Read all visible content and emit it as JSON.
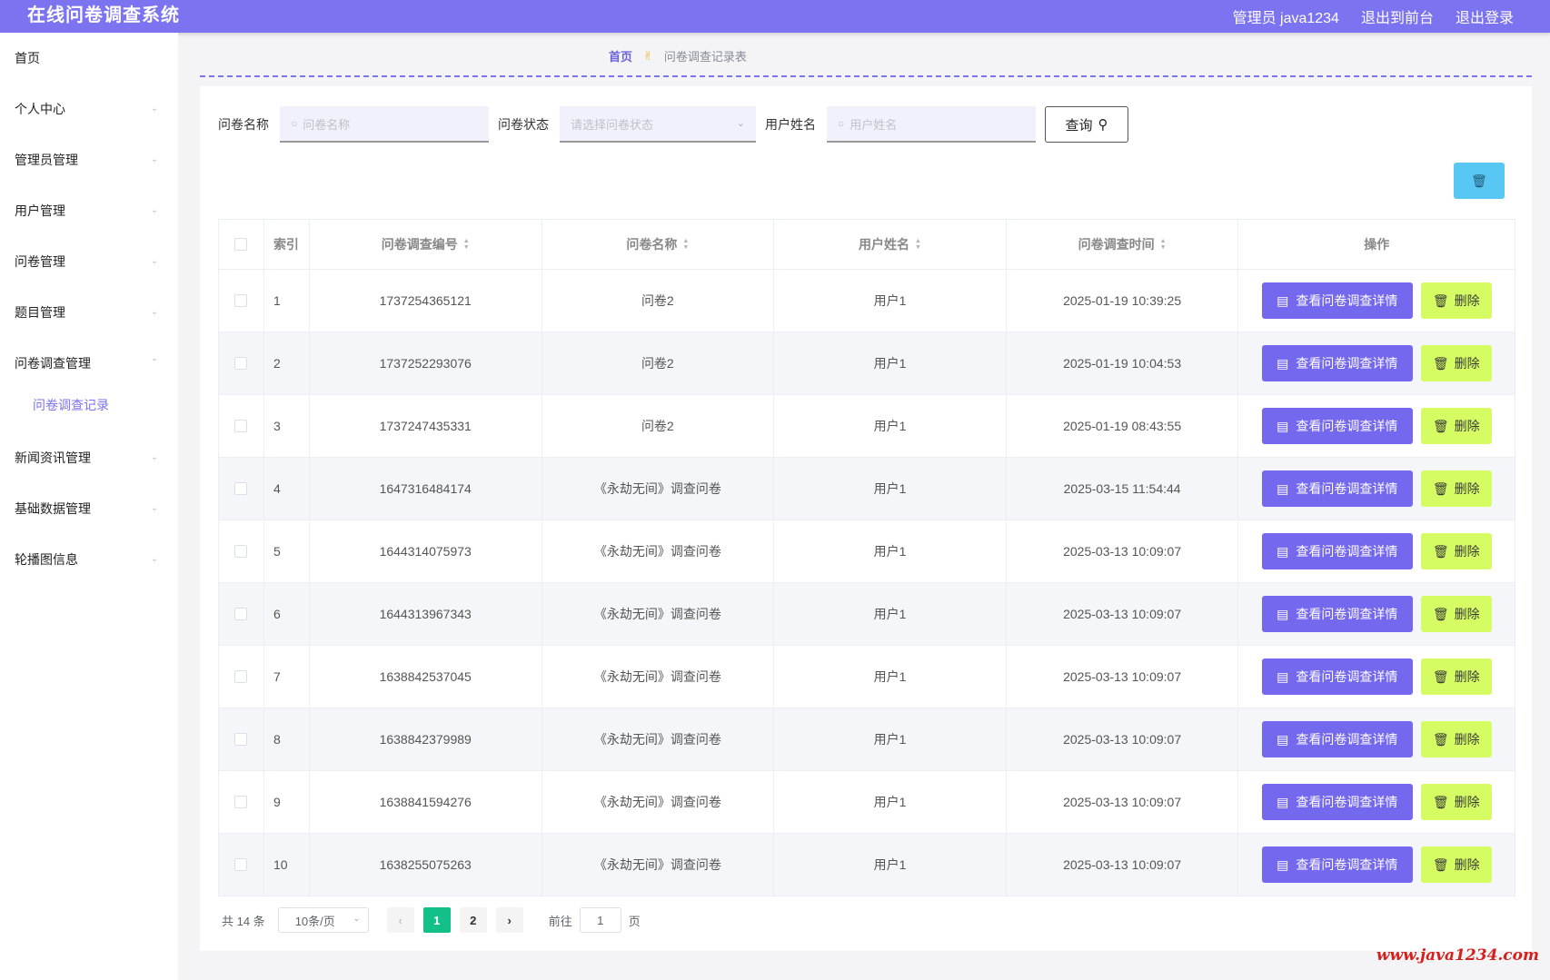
{
  "header": {
    "title": "在线问卷调查系统",
    "admin_label": "管理员 java1234",
    "to_front": "退出到前台",
    "logout": "退出登录",
    "bar_color": "#7c73f0"
  },
  "sidebar": {
    "items": [
      {
        "label": "首页",
        "chevron": ""
      },
      {
        "label": "个人中心",
        "chevron": "⌄"
      },
      {
        "label": "管理员管理",
        "chevron": "⌄"
      },
      {
        "label": "用户管理",
        "chevron": "⌄"
      },
      {
        "label": "问卷管理",
        "chevron": "⌄"
      },
      {
        "label": "题目管理",
        "chevron": "⌄"
      },
      {
        "label": "问卷调查管理",
        "chevron": "⌃"
      },
      {
        "label": "新闻资讯管理",
        "chevron": "⌄"
      },
      {
        "label": "基础数据管理",
        "chevron": "⌄"
      },
      {
        "label": "轮播图信息",
        "chevron": "⌄"
      }
    ],
    "sub_item": "问卷调查记录"
  },
  "breadcrumb": {
    "home": "首页",
    "current": "问卷调查记录表"
  },
  "search": {
    "name_label": "问卷名称",
    "name_placeholder": "问卷名称",
    "status_label": "问卷状态",
    "status_placeholder": "请选择问卷状态",
    "user_label": "用户姓名",
    "user_placeholder": "用户姓名",
    "query_label": "查询"
  },
  "table": {
    "headers": {
      "index": "索引",
      "code": "问卷调查编号",
      "name": "问卷名称",
      "user": "用户姓名",
      "time": "问卷调查时间",
      "ops": "操作"
    },
    "view_label": "查看问卷调查详情",
    "delete_label": "删除",
    "rows": [
      {
        "index": "1",
        "code": "1737254365121",
        "name": "问卷2",
        "user": "用户1",
        "time": "2025-01-19 10:39:25"
      },
      {
        "index": "2",
        "code": "1737252293076",
        "name": "问卷2",
        "user": "用户1",
        "time": "2025-01-19 10:04:53"
      },
      {
        "index": "3",
        "code": "1737247435331",
        "name": "问卷2",
        "user": "用户1",
        "time": "2025-01-19 08:43:55"
      },
      {
        "index": "4",
        "code": "1647316484174",
        "name": "《永劫无间》调查问卷",
        "user": "用户1",
        "time": "2025-03-15 11:54:44"
      },
      {
        "index": "5",
        "code": "1644314075973",
        "name": "《永劫无间》调查问卷",
        "user": "用户1",
        "time": "2025-03-13 10:09:07"
      },
      {
        "index": "6",
        "code": "1644313967343",
        "name": "《永劫无间》调查问卷",
        "user": "用户1",
        "time": "2025-03-13 10:09:07"
      },
      {
        "index": "7",
        "code": "1638842537045",
        "name": "《永劫无间》调查问卷",
        "user": "用户1",
        "time": "2025-03-13 10:09:07"
      },
      {
        "index": "8",
        "code": "1638842379989",
        "name": "《永劫无间》调查问卷",
        "user": "用户1",
        "time": "2025-03-13 10:09:07"
      },
      {
        "index": "9",
        "code": "1638841594276",
        "name": "《永劫无间》调查问卷",
        "user": "用户1",
        "time": "2025-03-13 10:09:07"
      },
      {
        "index": "10",
        "code": "1638255075263",
        "name": "《永劫无间》调查问卷",
        "user": "用户1",
        "time": "2025-03-13 10:09:07"
      }
    ]
  },
  "pagination": {
    "total": "共 14 条",
    "page_size": "10条/页",
    "pages": [
      "1",
      "2"
    ],
    "current_page": "1",
    "goto_prefix": "前往",
    "goto_value": "1",
    "goto_suffix": "页"
  },
  "watermark": "www.java1234.com",
  "colors": {
    "accent": "#7c73f0",
    "view_button": "#7468ee",
    "delete_button": "#d5fd63",
    "bulk_delete": "#59c7f3",
    "active_page": "#13c08a",
    "watermark": "#d4201c"
  }
}
